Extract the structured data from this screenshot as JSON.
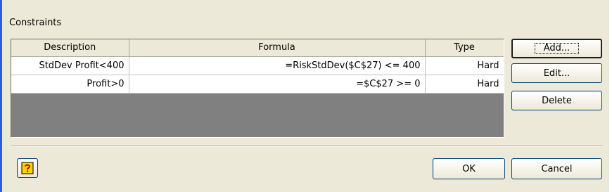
{
  "group": {
    "label": "Constraints"
  },
  "table": {
    "headers": [
      "Description",
      "Formula",
      "Type"
    ],
    "rows": [
      {
        "description": "StdDev Profit<400",
        "formula": "=RiskStdDev($C$27) <=  400",
        "type": "Hard"
      },
      {
        "description": "Profit>0",
        "formula": "=$C$27 >=  0",
        "type": "Hard"
      }
    ]
  },
  "buttons": {
    "add": "Add...",
    "edit": "Edit...",
    "delete": "Delete",
    "ok": "OK",
    "cancel": "Cancel",
    "help_icon": "help-question-icon"
  },
  "colors": {
    "dialog_bg": "#ece9d8",
    "window_border": "#2a5fd6",
    "grid_empty": "#808080",
    "help_icon_fill": "#ffd200",
    "help_icon_mark": "#c00000"
  }
}
